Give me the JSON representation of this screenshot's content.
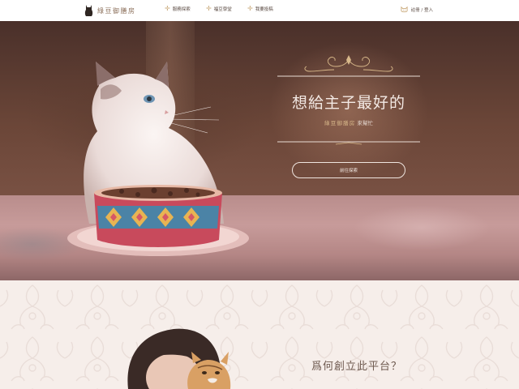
{
  "nav": {
    "brand": "綠豆御膳房",
    "items": [
      {
        "label": "服務探索",
        "icon": "plus-sparkle-icon"
      },
      {
        "label": "福豆學堂",
        "icon": "plus-sparkle-icon"
      },
      {
        "label": "我要投稿",
        "icon": "plus-sparkle-icon"
      }
    ],
    "login_label": "註冊 / 登入",
    "login_icon": "cat-face-icon"
  },
  "hero": {
    "title": "想給主子最好的",
    "subtitle_brand": "綠豆御膳房",
    "subtitle_rest": "來幫忙",
    "button_label": "前往探索"
  },
  "about": {
    "title": "爲何創立此平台？"
  },
  "colors": {
    "accent_gold": "#c9a97a",
    "text_dark": "#5a4a42",
    "hero_text": "#f3e9e4"
  }
}
